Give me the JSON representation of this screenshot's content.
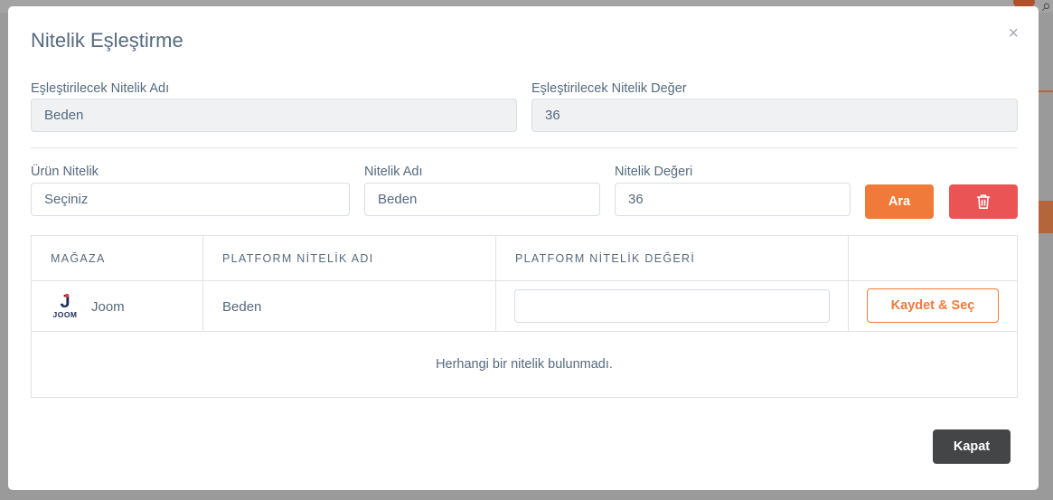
{
  "modal": {
    "title": "Nitelik Eşleştirme",
    "close_symbol": "×"
  },
  "mapping": {
    "name_label": "Eşleştirilecek Nitelik Adı",
    "name_value": "Beden",
    "value_label": "Eşleştirilecek Nitelik Değer",
    "value_value": "36"
  },
  "filters": {
    "product_attr_label": "Ürün Nitelik",
    "product_attr_value": "Seçiniz",
    "attr_name_label": "Nitelik Adı",
    "attr_name_value": "Beden",
    "attr_value_label": "Nitelik Değeri",
    "attr_value_value": "36",
    "search_button": "Ara",
    "delete_icon": "trash-icon"
  },
  "table": {
    "headers": [
      "MAĞAZA",
      "PLATFORM NİTELİK ADI",
      "PLATFORM NİTELİK DEĞERİ",
      ""
    ],
    "rows": [
      {
        "store_logo_text": "JOOM",
        "store": "Joom",
        "platform_attr_name": "Beden",
        "platform_attr_value": "",
        "action": "Kaydet & Seç"
      }
    ],
    "empty_message": "Herhangi bir nitelik bulunmadı."
  },
  "footer": {
    "close_button": "Kapat"
  },
  "colors": {
    "accent": "#f07a3a",
    "danger": "#ea5455",
    "dark": "#444546"
  }
}
